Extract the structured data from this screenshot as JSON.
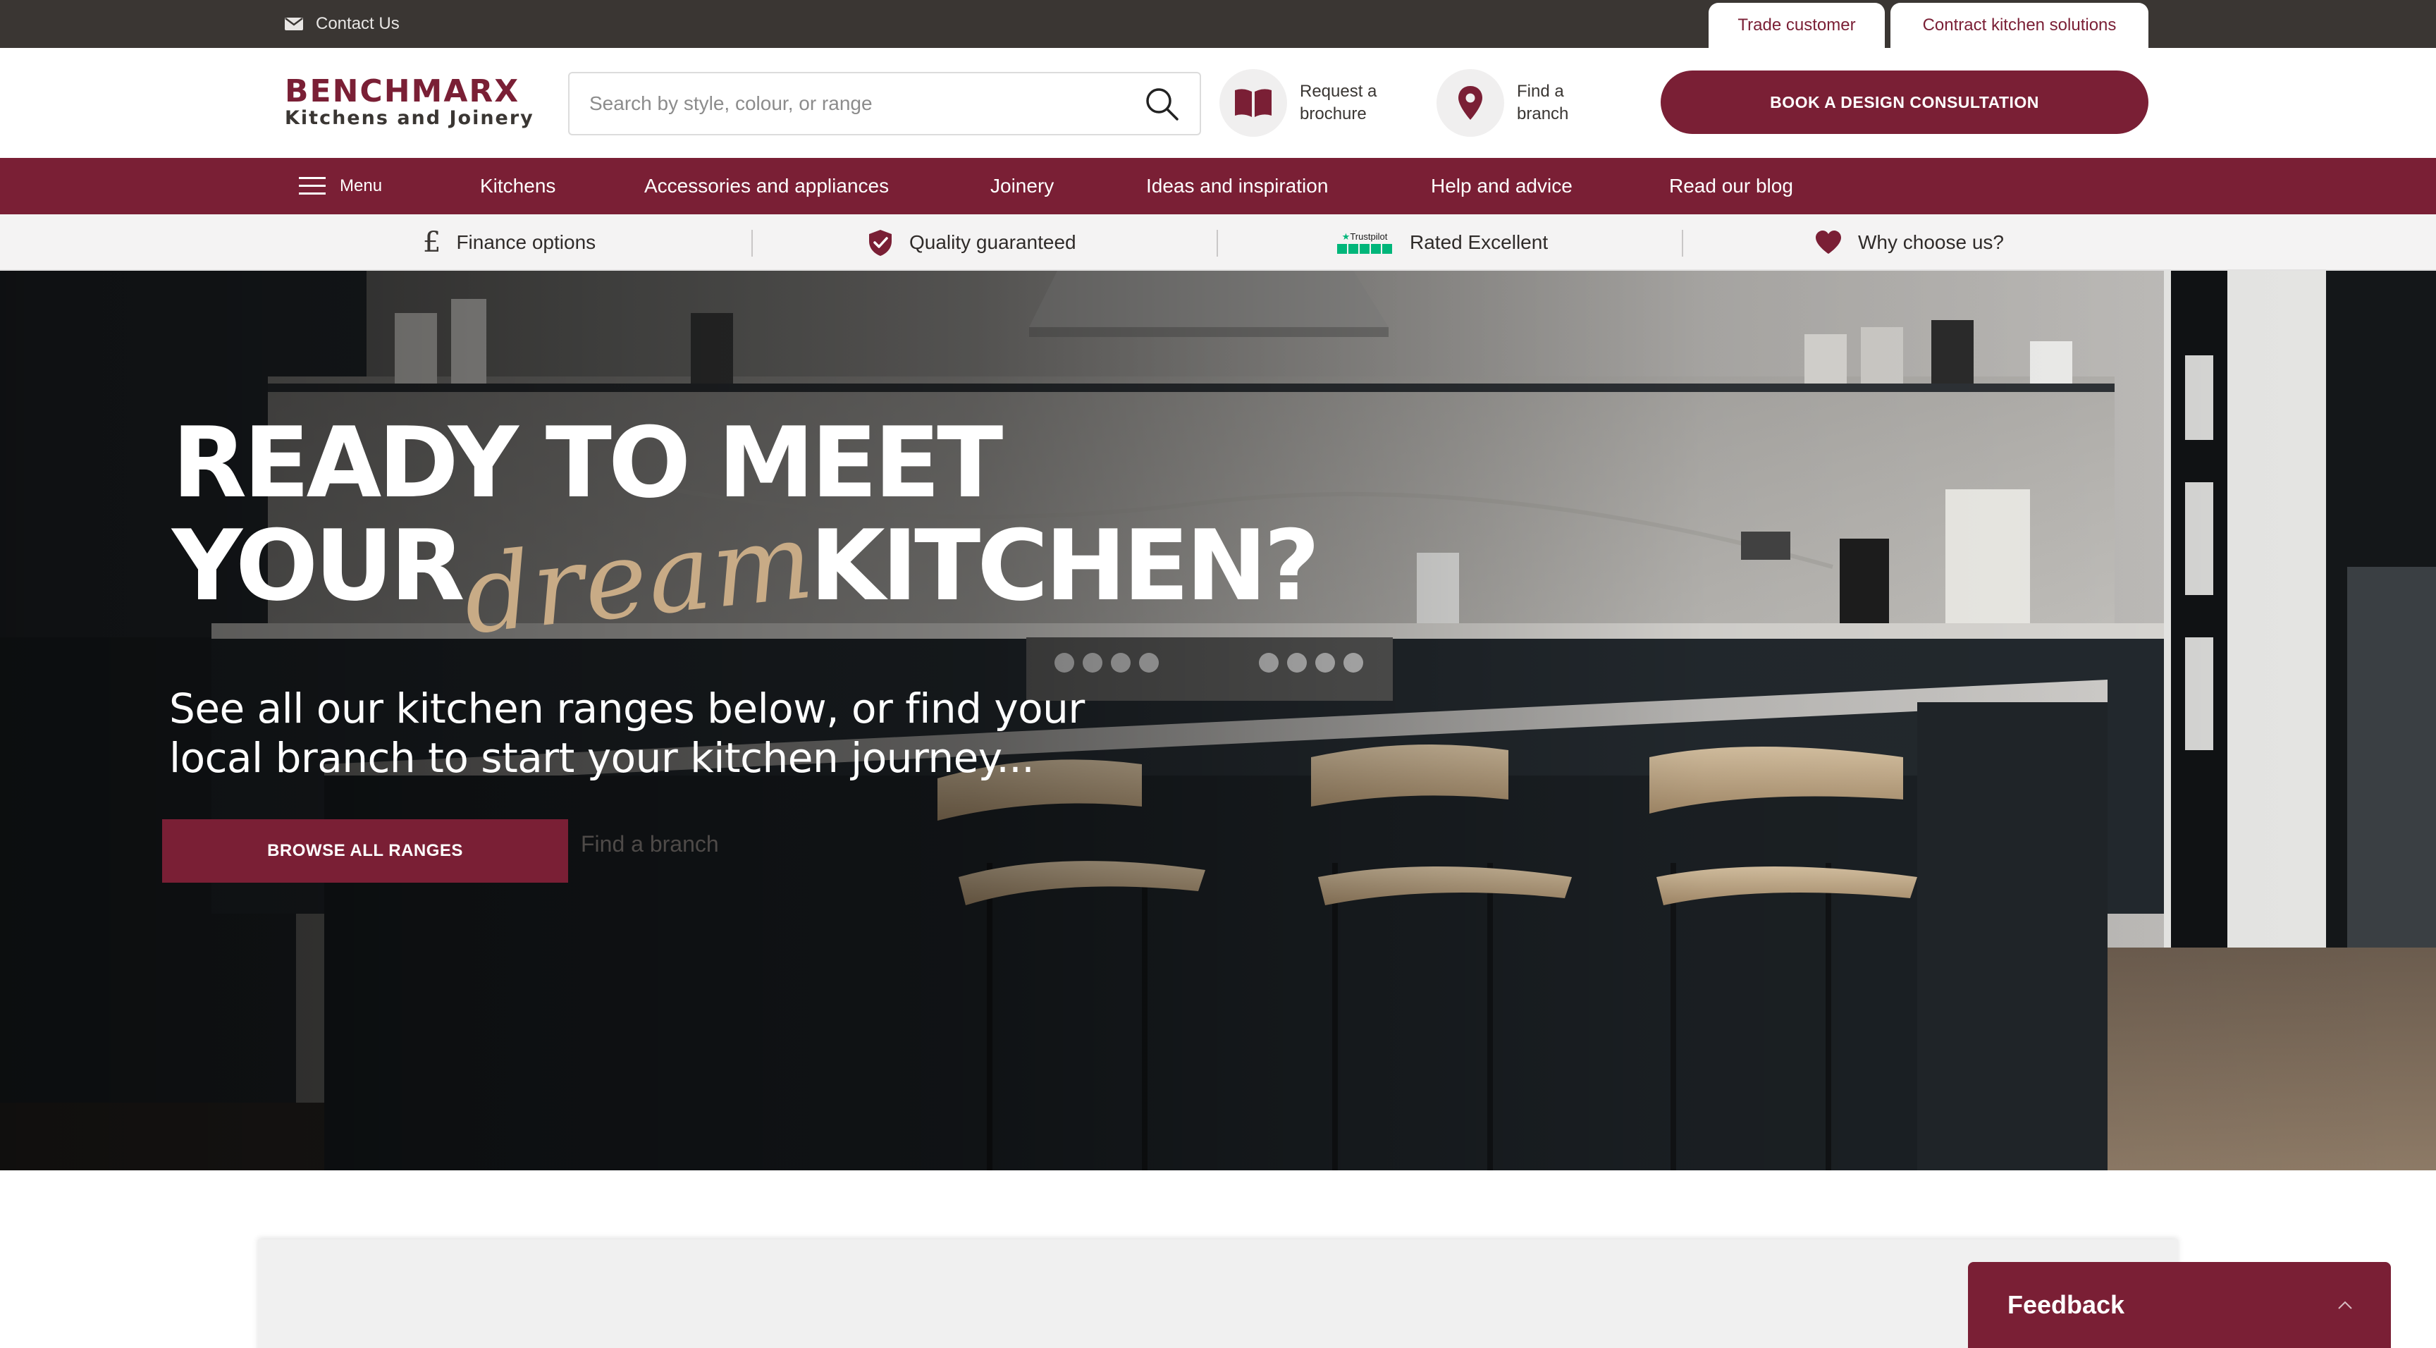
{
  "topbar": {
    "contact_label": "Contact Us",
    "trade_label": "Trade customer",
    "contract_label": "Contract kitchen solutions"
  },
  "header": {
    "logo_main": "BENCHMARX",
    "logo_sub": "Kitchens and Joinery",
    "search_placeholder": "Search by style, colour, or range",
    "brochure_label": "Request a brochure",
    "branch_label": "Find a branch",
    "consult_label": "BOOK A DESIGN CONSULTATION"
  },
  "nav": {
    "menu_label": "Menu",
    "items": [
      "Kitchens",
      "Accessories and appliances",
      "Joinery",
      "Ideas and inspiration",
      "Help and advice",
      "Read our blog"
    ]
  },
  "usp": {
    "finance": "Finance options",
    "quality": "Quality guaranteed",
    "trustpilot_word": "Trustpilot",
    "rated": "Rated Excellent",
    "why": "Why choose us?"
  },
  "hero": {
    "line1": "READY TO MEET",
    "line2_a": "YOUR",
    "line2_script": "dream",
    "line2_b": "KITCHEN?",
    "subtitle": "See all our kitchen ranges below, or find your local branch to start your kitchen journey...",
    "browse_label": "BROWSE ALL RANGES",
    "find_branch_label": "Find a branch"
  },
  "feedback": {
    "label": "Feedback"
  },
  "colors": {
    "brand": "#7a1f35",
    "topbar": "#3a3633",
    "usp_bg": "#f4f3f3",
    "trustpilot_green": "#00b67a",
    "script_gold": "#c8ab86"
  },
  "icons": {
    "contact": "envelope-icon",
    "search": "search-icon",
    "brochure": "book-icon",
    "branch": "map-pin-icon",
    "menu": "hamburger-icon",
    "finance": "pound-icon",
    "quality": "shield-check-icon",
    "why": "heart-icon",
    "feedback": "chevron-up-icon"
  }
}
